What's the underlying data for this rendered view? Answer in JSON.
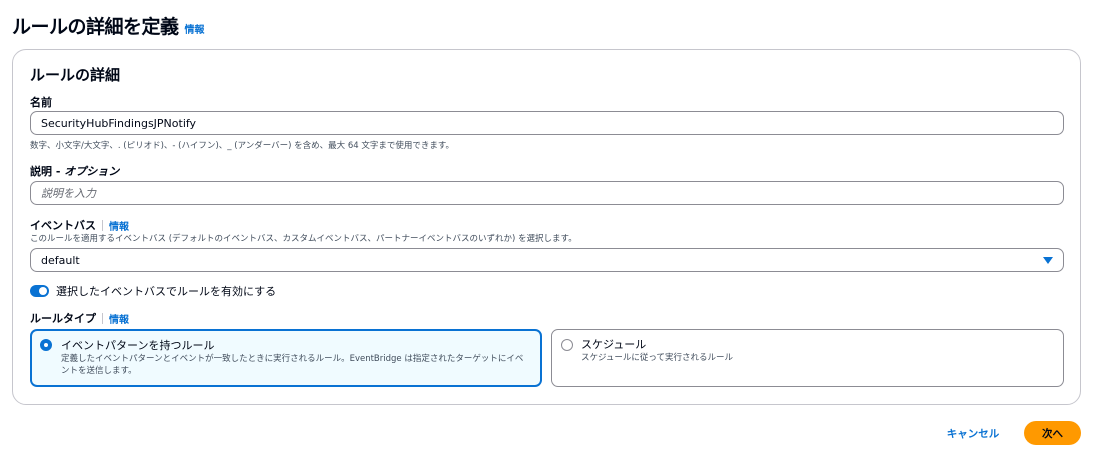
{
  "page": {
    "title": "ルールの詳細を定義",
    "info": "情報"
  },
  "container": {
    "title": "ルールの詳細"
  },
  "name_field": {
    "label": "名前",
    "value": "SecurityHubFindingsJPNotify",
    "hint": "数字、小文字/大文字、. (ピリオド)、- (ハイフン)、_ (アンダーバー) を含め、最大 64 文字まで使用できます。"
  },
  "description_field": {
    "label": "説明 - ",
    "optional": "オプション",
    "placeholder": "説明を入力"
  },
  "event_bus": {
    "label": "イベントバス",
    "info": "情報",
    "hint": "このルールを適用するイベントバス (デフォルトのイベントバス、カスタムイベントバス、パートナーイベントバスのいずれか) を選択します。",
    "selected": "default"
  },
  "toggle": {
    "label": "選択したイベントバスでルールを有効にする",
    "enabled": true
  },
  "rule_type": {
    "label": "ルールタイプ",
    "info": "情報",
    "options": [
      {
        "title": "イベントパターンを持つルール",
        "desc": "定義したイベントパターンとイベントが一致したときに実行されるルール。EventBridge は指定されたターゲットにイベントを送信します。",
        "selected": true
      },
      {
        "title": "スケジュール",
        "desc": "スケジュールに従って実行されるルール",
        "selected": false
      }
    ]
  },
  "footer": {
    "cancel": "キャンセル",
    "next": "次へ"
  },
  "colors": {
    "accent": "#0972d3",
    "primary_button": "#ff9900"
  }
}
